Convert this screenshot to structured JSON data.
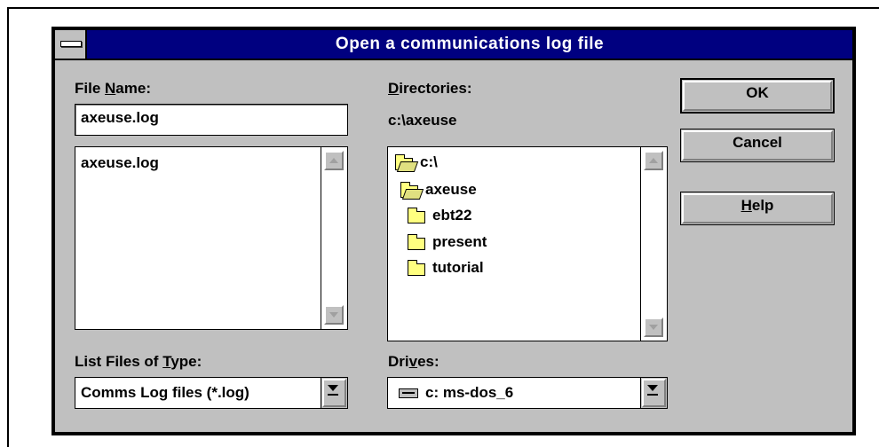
{
  "dialog": {
    "title": "Open a communications log file"
  },
  "file_name": {
    "label_prefix": "File ",
    "label_hotkey": "N",
    "label_suffix": "ame:",
    "value": "axeuse.log",
    "files": [
      "axeuse.log"
    ]
  },
  "directories": {
    "label_hotkey": "D",
    "label_suffix": "irectories:",
    "current_path": "c:\\axeuse",
    "items": [
      {
        "label": "c:\\",
        "icon": "open-folder-icon"
      },
      {
        "label": "axeuse",
        "icon": "open-folder-icon"
      },
      {
        "label": "ebt22",
        "icon": "folder-icon"
      },
      {
        "label": "present",
        "icon": "folder-icon"
      },
      {
        "label": "tutorial",
        "icon": "folder-icon"
      }
    ]
  },
  "file_type": {
    "label_prefix": "List Files of ",
    "label_hotkey": "T",
    "label_suffix": "ype:",
    "selected": "Comms Log files (*.log)"
  },
  "drives": {
    "label_prefix": "Dri",
    "label_hotkey": "v",
    "label_suffix": "es:",
    "selected": "c: ms-dos_6",
    "icon": "hard-drive-icon"
  },
  "buttons": {
    "ok": "OK",
    "cancel": "Cancel",
    "help_hotkey": "H",
    "help_suffix": "elp"
  },
  "colors": {
    "titlebar": "#000080",
    "face": "#c0c0c0",
    "folder": "#ffff80"
  }
}
